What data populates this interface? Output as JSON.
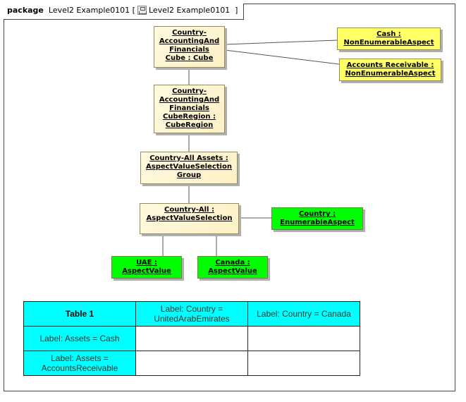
{
  "frame": {
    "keyword": "package",
    "name": "Level2 Example0101",
    "diagram_icon": "class-diagram-icon",
    "diagram_name": "Level2 Example0101"
  },
  "nodes": {
    "cube": {
      "line1": "Country-",
      "line2": "AccountingAnd",
      "line3": "Financials",
      "line4": "Cube : Cube"
    },
    "cash": {
      "line1": "Cash :",
      "line2": "NonEnumerableAspect"
    },
    "accounts_receivable": {
      "line1": "Accounts Receivable :",
      "line2": "NonEnumerableAspect"
    },
    "cube_region": {
      "line1": "Country-",
      "line2": "AccountingAnd",
      "line3": "Financials",
      "line4": "CubeRegion :",
      "line5": "CubeRegion"
    },
    "all_assets": {
      "line1": "Country-All Assets :",
      "line2": "AspectValueSelection",
      "line3": "Group"
    },
    "country_all": {
      "line1": "Country-All :",
      "line2": "AspectValueSelection"
    },
    "country": {
      "line1": "Country :",
      "line2": "EnumerableAspect"
    },
    "uae": {
      "line1": "UAE :",
      "line2": "AspectValue"
    },
    "canada": {
      "line1": "Canada :",
      "line2": "AspectValue"
    }
  },
  "colors": {
    "beige": "#fdf0c5",
    "yellow": "#ffff66",
    "green": "#00ff00",
    "cyan": "#00ffff"
  },
  "table": {
    "title": "Table 1",
    "columns": [
      "Label: Country = UnitedArabEmirates",
      "Label: Country = Canada"
    ],
    "rows": [
      {
        "label": "Label: Assets = Cash",
        "cells": [
          "",
          ""
        ]
      },
      {
        "label": "Label: Assets = AccountsReceivable",
        "cells": [
          "",
          ""
        ]
      }
    ]
  }
}
